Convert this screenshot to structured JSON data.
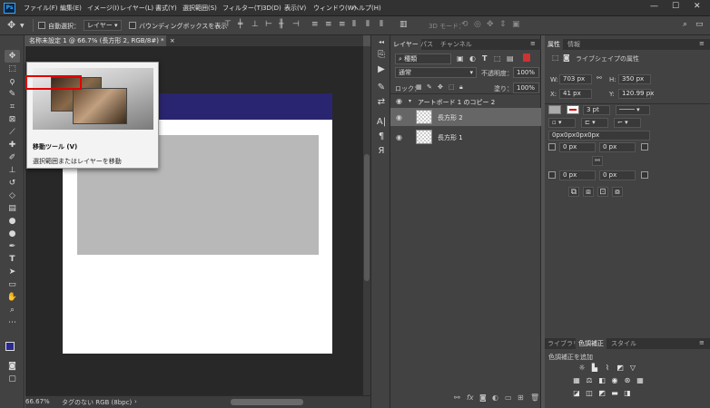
{
  "app": {
    "logo": "Ps"
  },
  "menu": [
    "ファイル(F)",
    "編集(E)",
    "イメージ(I)",
    "レイヤー(L)",
    "書式(Y)",
    "選択範囲(S)",
    "フィルター(T)",
    "3D(D)",
    "表示(V)",
    "ウィンドウ(W)",
    "ヘルプ(H)"
  ],
  "window_controls": [
    "—",
    "☐",
    "✕"
  ],
  "options": {
    "auto_select_label": "自動選択：",
    "auto_select_value": "レイヤー",
    "bounding_box_label": "バウンディングボックスを表示",
    "mode_3d_label": "3D モード："
  },
  "document": {
    "tab_title": "名称未設定 1 @ 66.7% (長方形 2, RGB/8#) *",
    "close": "×"
  },
  "status": {
    "zoom": "66.67%",
    "profile": "タグのない RGB (8bpc)",
    "arrow": "›"
  },
  "tooltip": {
    "title": "移動ツール (V)",
    "description": "選択範囲またはレイヤーを移動"
  },
  "layers_panel": {
    "tabs": [
      "レイヤー",
      "パス",
      "チャンネル"
    ],
    "filter_kind": "種類",
    "blend_mode": "通常",
    "opacity_label": "不透明度：",
    "opacity_value": "100%",
    "lock_label": "ロック：",
    "fill_label": "塗り：",
    "fill_value": "100%",
    "group_name": "アートボード 1 のコピー 2",
    "layers": [
      {
        "name": "長方形 2",
        "selected": true
      },
      {
        "name": "長方形 1",
        "selected": false
      }
    ]
  },
  "properties_panel": {
    "tabs": [
      "属性",
      "情報"
    ],
    "shape_title": "ライブシェイプの属性",
    "w_label": "W:",
    "w_value": "703 px",
    "h_label": "H:",
    "h_value": "350 px",
    "x_label": "X:",
    "x_value": "41 px",
    "y_label": "Y:",
    "y_value": "120.99 px",
    "stroke_width": "3 pt",
    "radius_all": "0px0px0px0px",
    "corner_tl": "0 px",
    "corner_tr": "0 px",
    "corner_bl": "0 px",
    "corner_br": "0 px"
  },
  "adjust_panel": {
    "tabs": [
      "ライブラリ",
      "色調補正",
      "スタイル"
    ],
    "add_label": "色調補正を追加"
  },
  "colors": {
    "artboard_header": "#2a2570",
    "tooltip_highlight": "#e00000",
    "ps_blue": "#31a8ff"
  }
}
